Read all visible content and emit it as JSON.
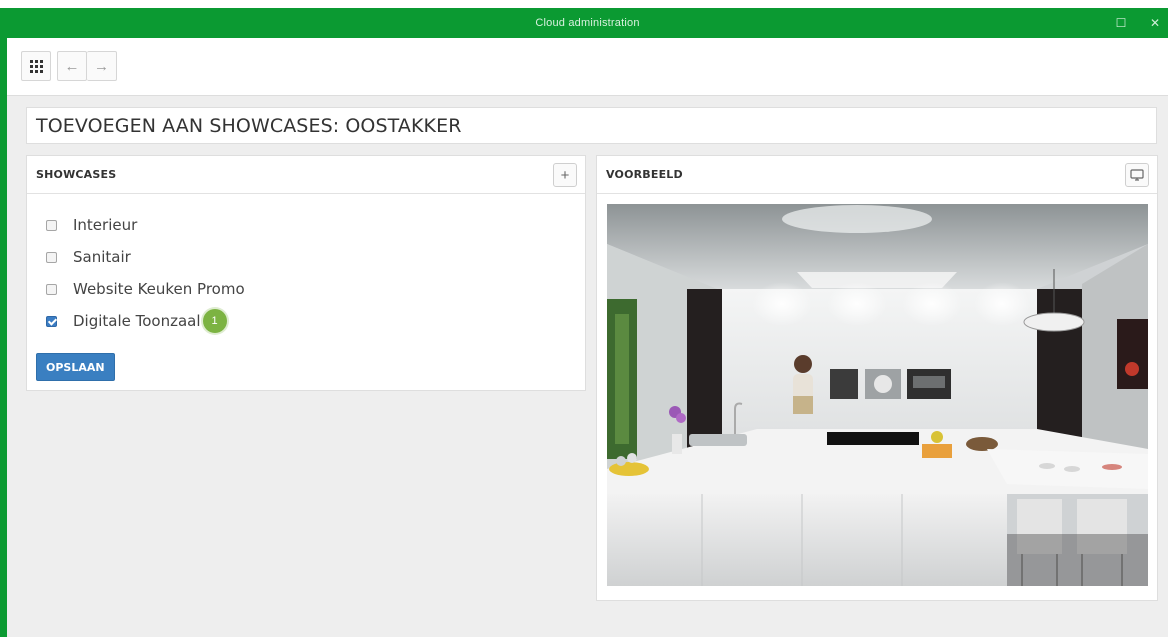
{
  "window": {
    "title": "Cloud administration",
    "maximize_glyph": "☐",
    "close_glyph": "✕",
    "accent_color": "#0b9a32"
  },
  "toolbar": {
    "apps_icon": "grid-icon",
    "back_glyph": "←",
    "forward_glyph": "→"
  },
  "page": {
    "title": "TOEVOEGEN AAN SHOWCASES: OOSTAKKER"
  },
  "showcases_panel": {
    "title": "SHOWCASES",
    "add_glyph": "+",
    "items": [
      {
        "label": "Interieur",
        "checked": false
      },
      {
        "label": "Sanitair",
        "checked": false
      },
      {
        "label": "Website Keuken Promo",
        "checked": false
      },
      {
        "label": "Digitale Toonzaal",
        "checked": true,
        "badge": "1"
      }
    ],
    "save_label": "OPSLAAN"
  },
  "preview_panel": {
    "title": "VOORBEELD",
    "monitor_icon": "monitor-icon"
  }
}
